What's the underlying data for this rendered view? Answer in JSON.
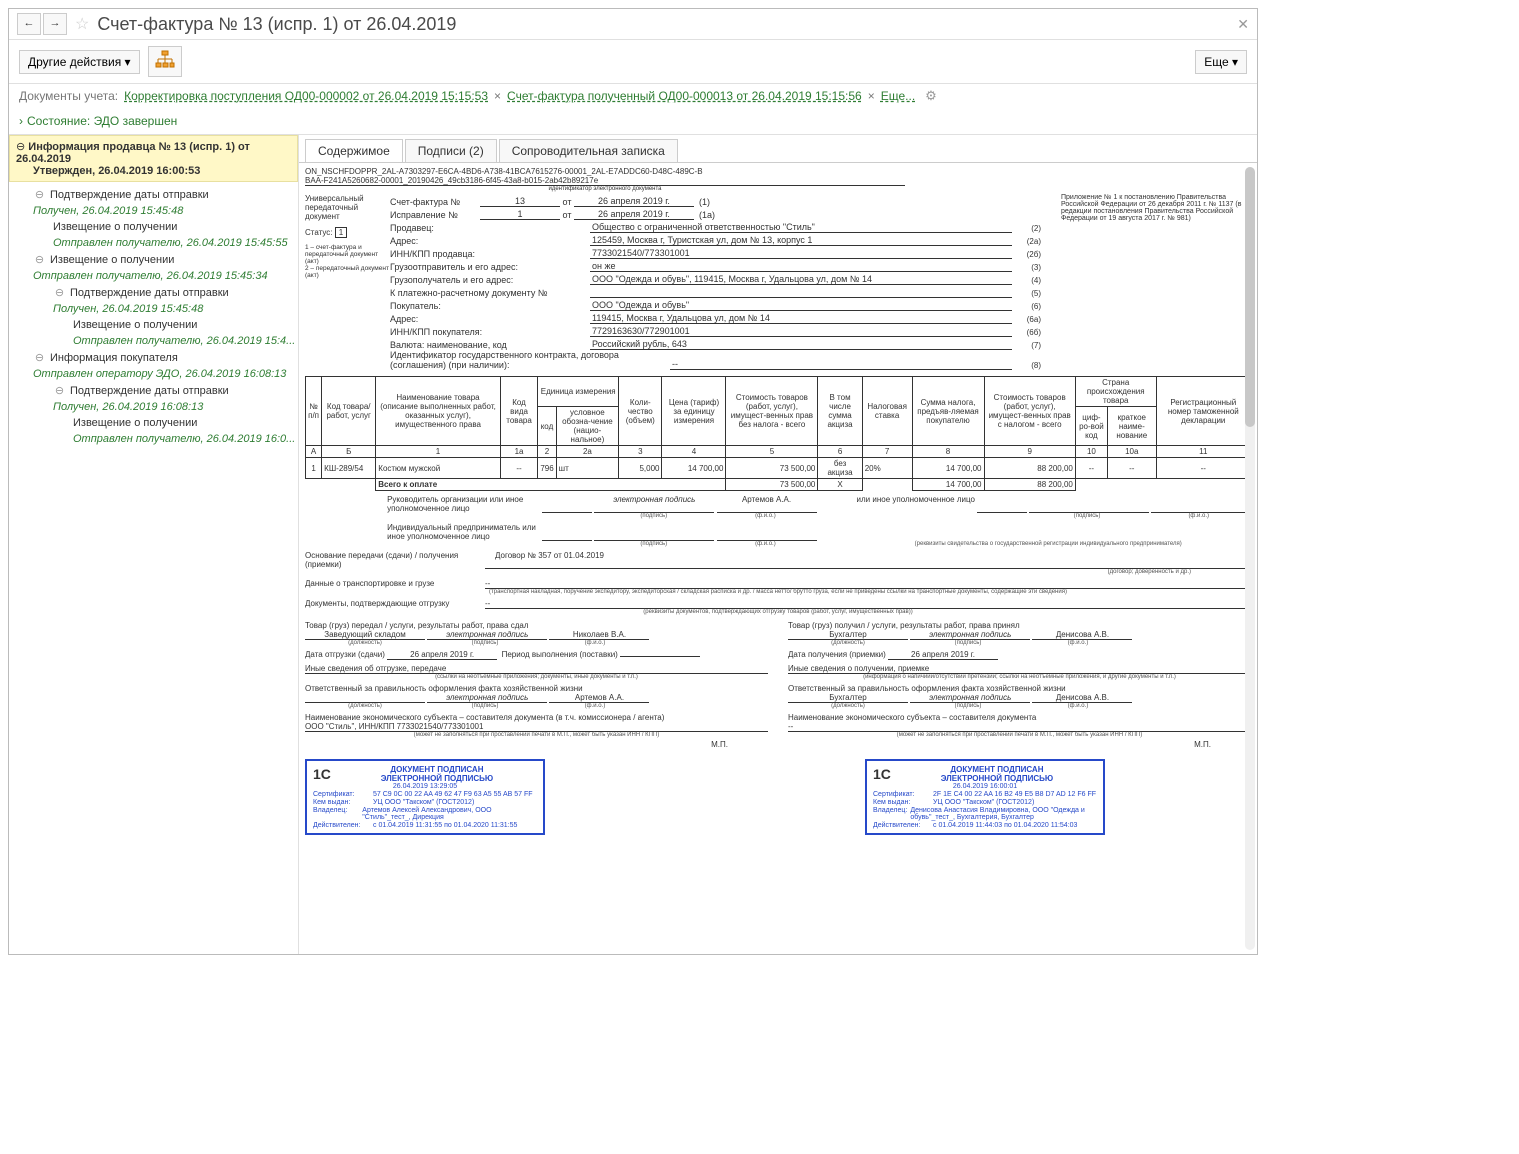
{
  "title": "Счет-фактура № 13 (испр. 1) от 26.04.2019",
  "toolbar": {
    "other_actions": "Другие действия",
    "more": "Еще"
  },
  "doclinks": {
    "label": "Документы учета:",
    "link1": "Корректировка поступления ОД00-000002 от 26.04.2019 15:15:53",
    "link2": "Счет-фактура полученный ОД00-000013 от 26.04.2019 15:15:56",
    "more": "Еще..."
  },
  "state_label": "Состояние:",
  "state_value": "ЭДО завершен",
  "side": {
    "hdr": "Информация продавца № 13 (испр. 1) от 26.04.2019",
    "approved": "Утвержден, 26.04.2019 16:00:53",
    "nodes": [
      {
        "lvl": 1,
        "tog": "⊖",
        "text": "Подтверждение даты отправки"
      },
      {
        "lvl": 1,
        "green": true,
        "text": "Получен, 26.04.2019 15:45:48"
      },
      {
        "lvl": 2,
        "text": "Извещение о получении"
      },
      {
        "lvl": 2,
        "green": true,
        "text": "Отправлен получателю, 26.04.2019 15:45:55"
      },
      {
        "lvl": 1,
        "tog": "⊖",
        "text": "Извещение о получении"
      },
      {
        "lvl": 1,
        "green": true,
        "text": "Отправлен получателю, 26.04.2019 15:45:34"
      },
      {
        "lvl": 2,
        "tog": "⊖",
        "text": "Подтверждение даты отправки"
      },
      {
        "lvl": 2,
        "green": true,
        "text": "Получен, 26.04.2019 15:45:48"
      },
      {
        "lvl": 3,
        "text": "Извещение о получении"
      },
      {
        "lvl": 3,
        "green": true,
        "text": "Отправлен получателю, 26.04.2019 15:4..."
      },
      {
        "lvl": 1,
        "tog": "⊖",
        "text": "Информация покупателя"
      },
      {
        "lvl": 1,
        "green": true,
        "text": "Отправлен оператору ЭДО, 26.04.2019 16:08:13"
      },
      {
        "lvl": 2,
        "tog": "⊖",
        "text": "Подтверждение даты отправки"
      },
      {
        "lvl": 2,
        "green": true,
        "text": "Получен, 26.04.2019 16:08:13"
      },
      {
        "lvl": 3,
        "text": "Извещение о получении"
      },
      {
        "lvl": 3,
        "green": true,
        "text": "Отправлен получателю, 26.04.2019 16:0..."
      }
    ]
  },
  "tabs": {
    "content": "Содержимое",
    "signatures": "Подписи (2)",
    "note": "Сопроводительная записка"
  },
  "doc": {
    "id1": "ON_NSCHFDOPPR_2AL-A7303297-E6CA-4BD6-A738-41BCA7615276-00001_2AL-E7ADDC60-D48C-489C-B",
    "id2": "BAA-F241A5260682-00001_20190426_49cb3186-6f45-43a8-b015-2ab42b89217e",
    "idcap": "идентификатор электронного документа",
    "leftbox": {
      "l1": "Универсальный",
      "l2": "передаточный",
      "l3": "документ",
      "status": "Статус:",
      "status_val": "1",
      "n1": "1 – счет-фактура и",
      "n2": "передаточный документ",
      "n3": "(акт)",
      "n4": "2 – передаточный документ",
      "n5": "(акт)"
    },
    "top_note": "Приложение № 1 к постановлению Правительства Российской Федерации от 26 декабря 2011 г. № 1137\n(в редакции постановления Правительства Российской Федерации от 19 августа 2017 г. № 981)",
    "invoice": {
      "sf_lbl": "Счет-фактура №",
      "sf_no": "13",
      "sf_ot": "от",
      "sf_date": "26 апреля 2019 г.",
      "sf_code": "(1)",
      "ispr_lbl": "Исправление №",
      "ispr_no": "1",
      "ispr_ot": "от",
      "ispr_date": "26 апреля 2019 г.",
      "ispr_code": "(1а)",
      "seller_lbl": "Продавец:",
      "seller": "Общество с ограниченной ответственностью \"Стиль\"",
      "seller_code": "(2)",
      "addr_lbl": "Адрес:",
      "addr": "125459, Москва г, Туристская ул, дом № 13, корпус 1",
      "addr_code": "(2а)",
      "inn_seller_lbl": "ИНН/КПП продавца:",
      "inn_seller": "7733021540/773301001",
      "inn_seller_code": "(2б)",
      "shipper_lbl": "Грузоотправитель и его адрес:",
      "shipper": "он же",
      "shipper_code": "(3)",
      "consignee_lbl": "Грузополучатель и его адрес:",
      "consignee": "ООО \"Одежда и обувь\", 119415, Москва г, Удальцова ул, дом № 14",
      "consignee_code": "(4)",
      "paydoc_lbl": "К платежно-расчетному документу №",
      "paydoc": "",
      "paydoc_code": "(5)",
      "buyer_lbl": "Покупатель:",
      "buyer": "ООО \"Одежда и обувь\"",
      "buyer_code": "(6)",
      "baddr_lbl": "Адрес:",
      "baddr": "119415, Москва г, Удальцова ул, дом № 14",
      "baddr_code": "(6а)",
      "binn_lbl": "ИНН/КПП покупателя:",
      "binn": "7729163630/772901001",
      "binn_code": "(6б)",
      "curr_lbl": "Валюта: наименование, код",
      "curr": "Российский рубль, 643",
      "curr_code": "(7)",
      "gos_lbl": "Идентификатор государственного контракта, договора (соглашения) (при наличии):",
      "gos": "--",
      "gos_code": "(8)"
    },
    "th": {
      "npp": "№ п/п",
      "code": "Код товара/ работ, услуг",
      "name": "Наименование товара (описание выполненных работ, оказанных услуг), имущественного права",
      "vid": "Код вида товара",
      "unit": "Единица измерения",
      "unit_code": "код",
      "unit_name": "условное обозна-чение (нацио-нальное)",
      "qty": "Коли-чество (объем)",
      "price": "Цена (тариф) за единицу измерения",
      "cost": "Стоимость товаров (работ, услуг), имущест-венных прав без налога - всего",
      "excise": "В том числе сумма акциза",
      "rate": "Налоговая ставка",
      "tax": "Сумма налога, предъяв-ляемая покупателю",
      "total": "Стоимость товаров (работ, услуг), имущест-венных прав с налогом - всего",
      "country": "Страна происхождения товара",
      "c_code": "циф-ро-вой код",
      "c_name": "краткое наиме-нование",
      "decl": "Регистрационный номер таможенной декларации",
      "rA": "А",
      "rB": "Б",
      "r1": "1",
      "r1a": "1а",
      "r2": "2",
      "r2a": "2а",
      "r3": "3",
      "r4": "4",
      "r5": "5",
      "r6": "6",
      "r7": "7",
      "r8": "8",
      "r9": "9",
      "r10": "10",
      "r10a": "10а",
      "r11": "11"
    },
    "row": {
      "n": "1",
      "code": "КШ-289/54",
      "name": "Костюм мужской",
      "vid": "--",
      "ucode": "796",
      "uname": "шт",
      "qty": "5,000",
      "price": "14 700,00",
      "cost": "73 500,00",
      "excise": "без акциза",
      "rate": "20%",
      "tax": "14 700,00",
      "total": "88 200,00",
      "cc": "--",
      "cn": "--",
      "decl": "--"
    },
    "total": {
      "lbl": "Всего к оплате",
      "cost": "73 500,00",
      "x": "Х",
      "tax": "14 700,00",
      "total": "88 200,00"
    },
    "sig": {
      "head_lbl": "Руководитель организации или иное уполномоченное лицо",
      "esign": "электронная подпись",
      "head_name": "Артемов А.А.",
      "acc_lbl": "или иное уполномоченное лицо",
      "ip_lbl": "Индивидуальный предприниматель или иное уполномоченное лицо",
      "sub_sign": "(подпись)",
      "sub_fio": "(ф.и.о.)",
      "rekv": "(реквизиты свидетельства о государственной регистрации индивидуального предпринимателя)"
    },
    "basis_lbl": "Основание передачи (сдачи) / получения (приемки)",
    "basis_val": "Договор № 357 от 01.04.2019",
    "basis_sub": "(договор; доверенность и др.)",
    "transport_lbl": "Данные о транспортировке и грузе",
    "transport_val": "--",
    "transport_sub": "(транспортная накладная, поручение экспедитору, экспедиторская / складская расписка и др. / масса нетто/ брутто груза, если не приведены ссылки на транспортные документы, содержащие эти сведения)",
    "docs_lbl": "Документы, подтверждающие отгрузку",
    "docs_val": "--",
    "docs_sub": "(реквизиты документов, подтверждающих отгрузку товаров (работ, услуг, имущественных прав))",
    "left": {
      "t": "Товар (груз) передал / услуги, результаты работ, права сдал",
      "post": "Заведующий складом",
      "post_sub": "(должность)",
      "esign": "электронная подпись",
      "name": "Николаев В.А.",
      "name_sub": "(ф.и.о.)",
      "date_lbl": "Дата отгрузки (сдачи)",
      "date": "26 апреля 2019 г.",
      "period": "Период выполнения (поставки)",
      "other_lbl": "Иные сведения об отгрузке, передаче",
      "other_sub": "(ссылки на неотъемные приложения; документы, иные документы и т.п.)",
      "resp": "Ответственный за правильность оформления факта хозяйственной жизни",
      "resp_post": "",
      "resp_esign": "электронная подпись",
      "resp_name": "Артемов А.А.",
      "org_lbl": "Наименование экономического субъекта – составителя документа (в т.ч. комиссионера / агента)",
      "org": "ООО \"Стиль\", ИНН/КПП 7733021540/773301001",
      "org_sub": "(может не заполняться при проставлении печати в М.П., может быть указан ИНН / КПП)",
      "mp": "М.П."
    },
    "right": {
      "t": "Товар (груз) получил / услуги, результаты работ, права принял",
      "post": "Бухгалтер",
      "esign": "электронная подпись",
      "name": "Денисова А.В.",
      "date_lbl": "Дата получения (приемки)",
      "date": "26 апреля 2019 г.",
      "other_lbl": "Иные сведения о получении, приемке",
      "other_sub": "(информация о напичиии/отсутствии претензий; ссылки на неотъемные приложения, и другие документы и т.п.)",
      "resp": "Ответственный за правильность оформления факта хозяйственной жизни",
      "resp_post": "Бухгалтер",
      "resp_esign": "электронная подпись",
      "resp_name": "Денисова А.В.",
      "org_lbl": "Наименование экономического субъекта – составителя документа",
      "org": "--",
      "mp": "М.П."
    },
    "stamp1": {
      "hdr": "ДОКУМЕНТ ПОДПИСАН\nЭЛЕКТРОННОЙ ПОДПИСЬЮ",
      "date": "26.04.2019 13:29:05",
      "cert_k": "Сертификат:",
      "cert": "57 C9 0C 00 22 AA 49 62 47 F9 63 A5 55 AB 57 FF",
      "issued_k": "Кем выдан:",
      "issued": "УЦ ООО \"Такском\" (ГОСТ2012)",
      "owner_k": "Владелец:",
      "owner": "Артемов Алексей Александрович, ООО \"Стиль\"_тест_, Дирекция",
      "valid_k": "Действителен:",
      "valid": "с 01.04.2019 11:31:55 по 01.04.2020 11:31:55"
    },
    "stamp2": {
      "hdr": "ДОКУМЕНТ ПОДПИСАН\nЭЛЕКТРОННОЙ ПОДПИСЬЮ",
      "date": "26.04.2019 16:00:01",
      "cert_k": "Сертификат:",
      "cert": "2F 1E C4 00 22 AA 16 B2 49 E5 B8 D7 AD 12 F6 FF",
      "issued_k": "Кем выдан:",
      "issued": "УЦ ООО \"Такском\" (ГОСТ2012)",
      "owner_k": "Владелец:",
      "owner": "Денисова Анастасия Владимировна, ООО \"Одежда и обувь\"_тест_, Бухгалтерия, Бухгалтер",
      "valid_k": "Действителен:",
      "valid": "с 01.04.2019 11:44:03 по 01.04.2020 11:54:03"
    }
  }
}
